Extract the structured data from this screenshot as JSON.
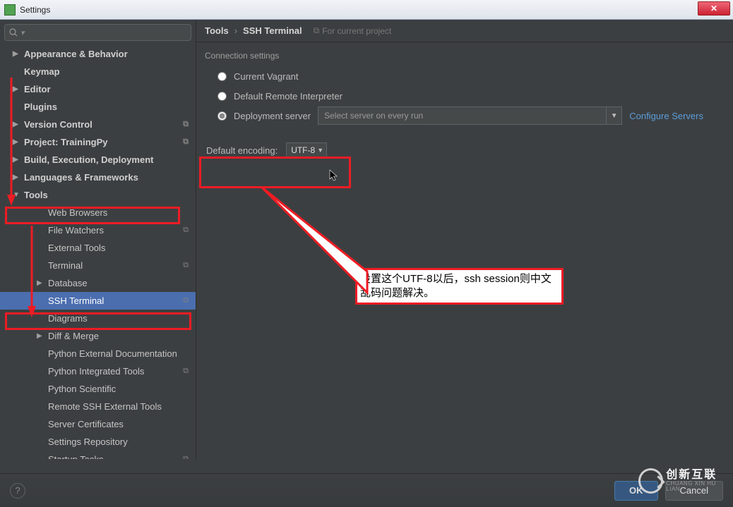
{
  "window": {
    "title": "Settings"
  },
  "search": {
    "placeholder": "Q"
  },
  "tree": {
    "top": [
      {
        "label": "Appearance & Behavior",
        "arrow": "▶",
        "bold": true
      },
      {
        "label": "Keymap",
        "arrow": "",
        "bold": true
      },
      {
        "label": "Editor",
        "arrow": "▶",
        "bold": true
      },
      {
        "label": "Plugins",
        "arrow": "",
        "bold": true
      },
      {
        "label": "Version Control",
        "arrow": "▶",
        "bold": true,
        "tag": "⧉"
      },
      {
        "label": "Project: TrainingPy",
        "arrow": "▶",
        "bold": true,
        "tag": "⧉"
      },
      {
        "label": "Build, Execution, Deployment",
        "arrow": "▶",
        "bold": true
      },
      {
        "label": "Languages & Frameworks",
        "arrow": "▶",
        "bold": true
      },
      {
        "label": "Tools",
        "arrow": "▼",
        "bold": true
      }
    ],
    "tools_children": [
      {
        "label": "Web Browsers"
      },
      {
        "label": "File Watchers",
        "tag": "⧉"
      },
      {
        "label": "External Tools"
      },
      {
        "label": "Terminal",
        "tag": "⧉"
      },
      {
        "label": "Database",
        "arrow": "▶"
      },
      {
        "label": "SSH Terminal",
        "selected": true,
        "tag": "⧉"
      },
      {
        "label": "Diagrams"
      },
      {
        "label": "Diff & Merge",
        "arrow": "▶"
      },
      {
        "label": "Python External Documentation"
      },
      {
        "label": "Python Integrated Tools",
        "tag": "⧉"
      },
      {
        "label": "Python Scientific"
      },
      {
        "label": "Remote SSH External Tools"
      },
      {
        "label": "Server Certificates"
      },
      {
        "label": "Settings Repository"
      },
      {
        "label": "Startup Tasks",
        "tag": "⧉"
      }
    ]
  },
  "breadcrumb": {
    "root": "Tools",
    "leaf": "SSH Terminal",
    "project_hint": "For current project"
  },
  "panel": {
    "section": "Connection settings",
    "radio_vagrant": "Current Vagrant",
    "radio_remote": "Default Remote Interpreter",
    "radio_deploy": "Deployment server",
    "server_placeholder": "Select server on every run",
    "configure": "Configure Servers",
    "encoding_label": "Default encoding:",
    "encoding_value": "UTF-8"
  },
  "annotation": {
    "note": "设置这个UTF-8以后，ssh session则中文乱码问题解决。"
  },
  "buttons": {
    "ok": "OK",
    "cancel": "Cancel"
  },
  "watermark": {
    "cn": "创新互联",
    "py": "CHUANG XIN HU LIAN"
  }
}
